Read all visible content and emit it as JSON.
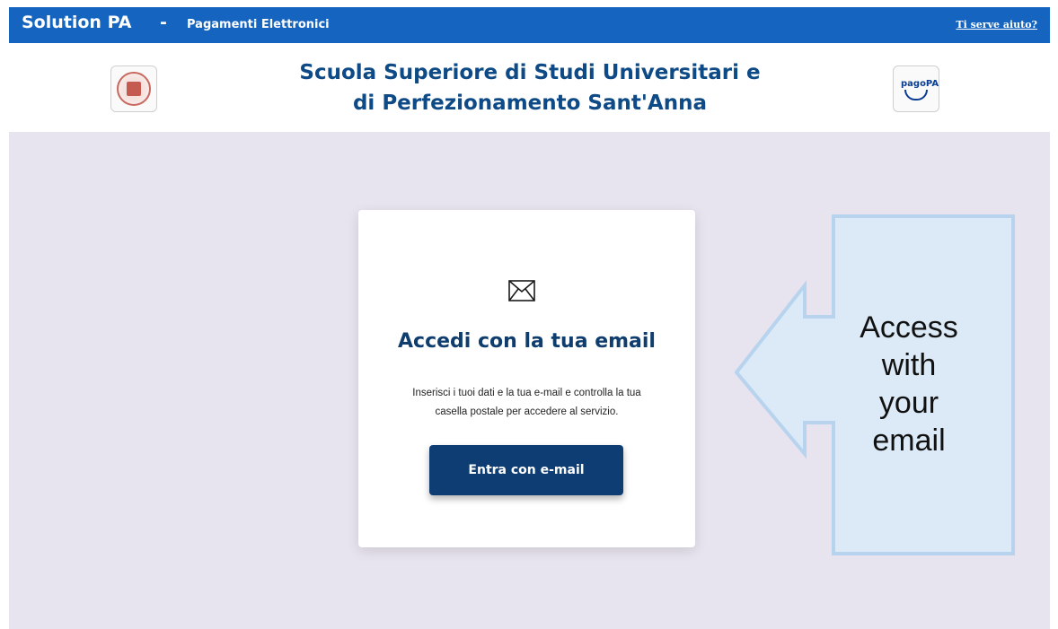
{
  "topbar": {
    "brand": "Solution PA",
    "separator": "-",
    "subtitle": "Pagamenti Elettronici",
    "help_link": "Ti serve aiuto?",
    "bg_color": "#1565c0"
  },
  "header": {
    "title_line1": "Scuola Superiore di Studi Universitari e",
    "title_line2": "di Perfezionamento Sant'Anna",
    "left_logo": "university-seal-logo",
    "right_logo_text": "pagoPA"
  },
  "card": {
    "icon": "mail-icon",
    "title": "Accedi con la tua email",
    "description_line1": "Inserisci i tuoi dati e la tua e-mail e controlla la tua",
    "description_line2": "casella postale per accedere al servizio.",
    "button_label": "Entra con e-mail",
    "button_color": "#0e3d73"
  },
  "callout": {
    "line1": "Access",
    "line2": "with",
    "line3": "your",
    "line4": "email",
    "fill_color": "#dbeaf6",
    "stroke_color": "#b7d3ee"
  }
}
